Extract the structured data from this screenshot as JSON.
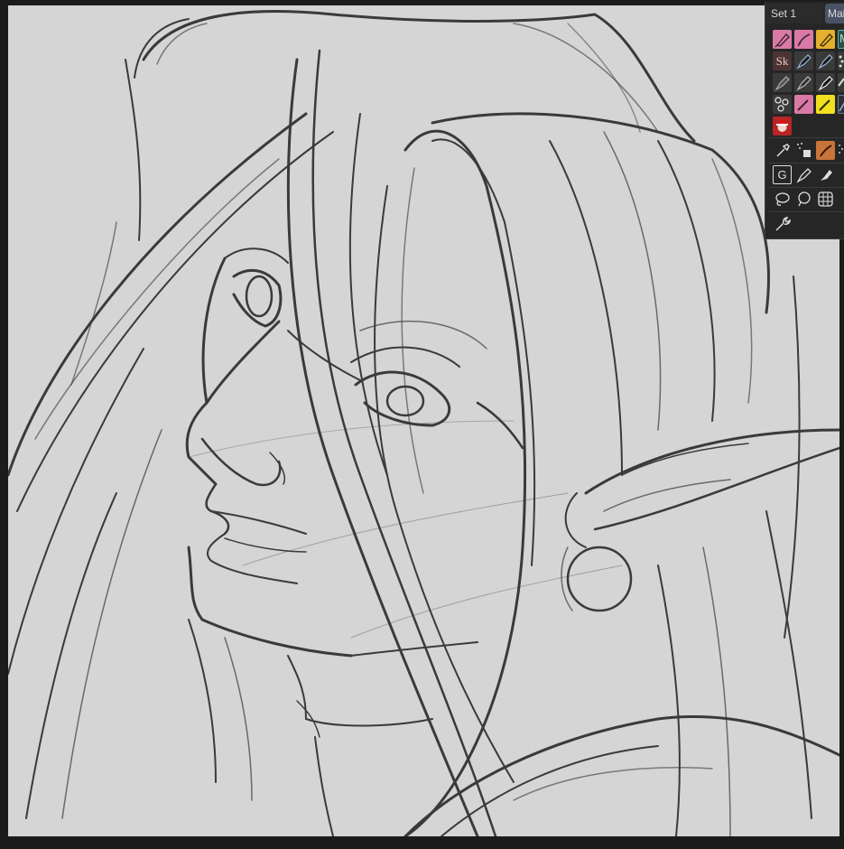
{
  "palette": {
    "set_tab_label": "Set 1",
    "main_tab_label": "Mai",
    "sketch_tool_label": "Sk",
    "text_tool_label": "G",
    "partial_tool_label": "M"
  },
  "colors": {
    "canvas_bg": "#d5d5d5",
    "workspace_bg": "#1b1b1b",
    "palette_bg": "#262626",
    "ink": "#3a3a3a",
    "pink_brush": "#d97aa6",
    "yellow_brush": "#e3b12e",
    "tab_active": "#4a5266"
  },
  "icons": [
    "pink-pen-icon",
    "pink-pen-2-icon",
    "yellow-pen-icon",
    "teal-marker-icon",
    "sketch-icon",
    "nib-pen-icon",
    "nib-pen-2-icon",
    "brush-dots-icon",
    "gray-pen-icon",
    "gray-pen-2-icon",
    "ink-pen-icon",
    "eraser-icon",
    "pattern-icon",
    "pink-pencil-icon",
    "yellow-pencil-icon",
    "selected-pen-icon",
    "santa-icon",
    "eyedropper-icon",
    "spray-icon",
    "orange-brush-icon",
    "text-g-icon",
    "fountain-pen-icon",
    "blender-icon",
    "lasso-icon",
    "lasso-2-icon",
    "grid-icon",
    "wrench-icon"
  ]
}
